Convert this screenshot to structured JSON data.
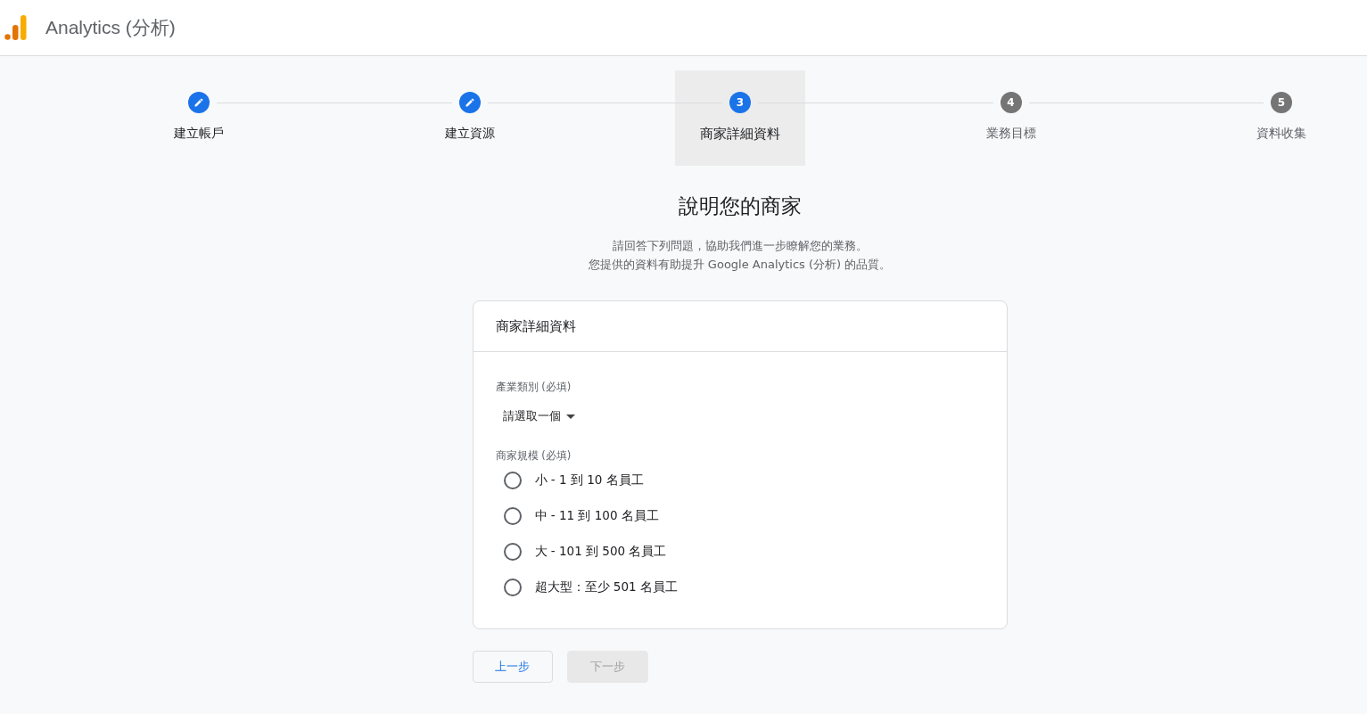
{
  "app_bar": {
    "title": "Analytics (分析)"
  },
  "steps": [
    {
      "label": "建立帳戶",
      "kind": "edit",
      "selected": false
    },
    {
      "label": "建立資源",
      "kind": "edit",
      "selected": false
    },
    {
      "label": "商家詳細資料",
      "number": "3",
      "kind": "current",
      "selected": true
    },
    {
      "label": "業務目標",
      "number": "4",
      "kind": "upcoming",
      "selected": false
    },
    {
      "label": "資料收集",
      "number": "5",
      "kind": "upcoming",
      "selected": false
    }
  ],
  "heading": "說明您的商家",
  "intro": [
    "請回答下列問題，協助我們進一步瞭解您的業務。",
    "您提供的資料有助提升 Google Analytics (分析) 的品質。"
  ],
  "card": {
    "title": "商家詳細資料",
    "industry": {
      "label": "產業類別 (必填)",
      "value": "請選取一個"
    },
    "size": {
      "label": "商家規模 (必填)",
      "options": [
        {
          "label": "小 - 1 到 10 名員工",
          "selected": false
        },
        {
          "label": "中 - 11 到 100 名員工",
          "selected": false
        },
        {
          "label": "大 - 101 到 500 名員工",
          "selected": false
        },
        {
          "label": "超大型：至少 501 名員工",
          "selected": false
        }
      ]
    }
  },
  "buttons": [
    {
      "label": "上一步",
      "disabled": false
    },
    {
      "label": "下一步",
      "disabled": true
    }
  ]
}
